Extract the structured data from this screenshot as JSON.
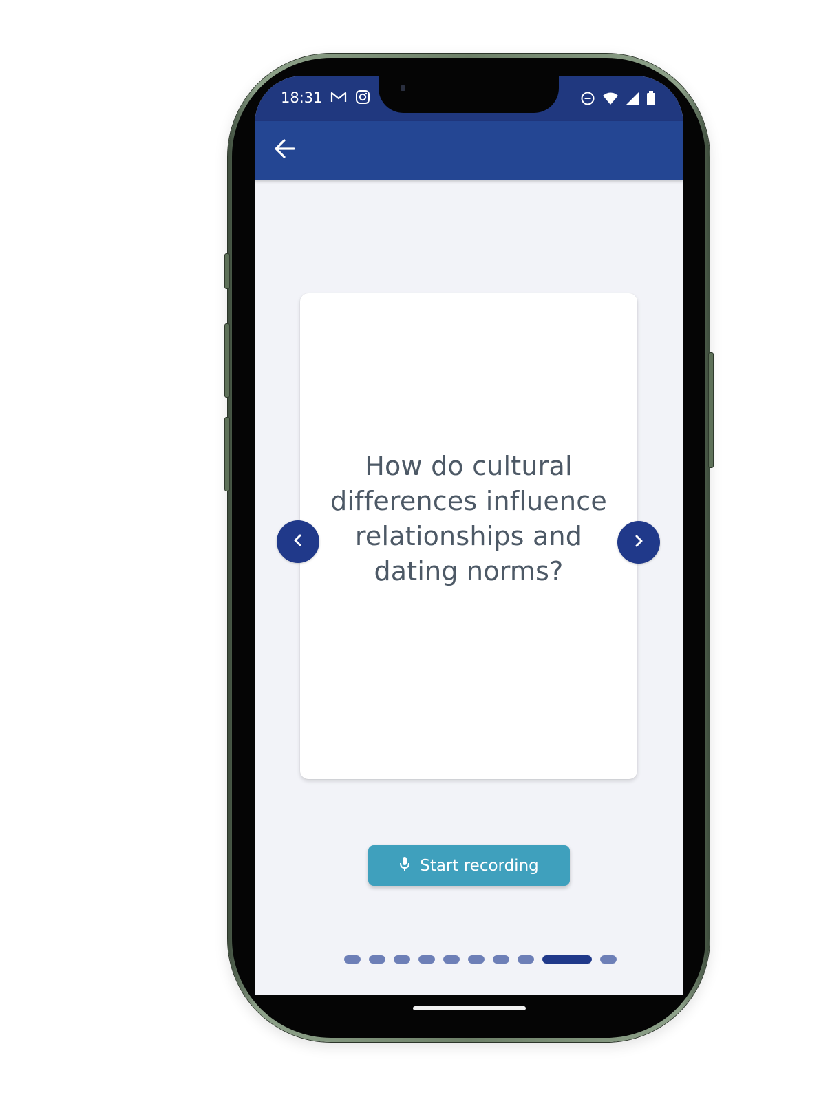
{
  "status_bar": {
    "time": "18:31",
    "left_icons": [
      "gmail-icon",
      "instagram-icon"
    ],
    "right_icons": [
      "do-not-disturb-icon",
      "wifi-icon",
      "signal-icon",
      "battery-icon"
    ]
  },
  "app_bar": {
    "back_icon": "arrow-left-icon"
  },
  "card": {
    "question": "How do cultural differences influence relationships and dating norms?"
  },
  "navigation": {
    "prev_icon": "chevron-left-icon",
    "next_icon": "chevron-right-icon"
  },
  "record_button": {
    "label": "Start recording",
    "icon": "microphone-icon"
  },
  "pagination": {
    "total": 10,
    "active_index": 8
  },
  "colors": {
    "status_bar": "#20387f",
    "app_bar": "#244693",
    "background": "#f2f3f8",
    "nav_button": "#20398a",
    "record_button": "#3fa0bd",
    "dot_inactive": "#6d7fb7",
    "dot_active": "#20398a",
    "question_text": "#4d5966"
  }
}
